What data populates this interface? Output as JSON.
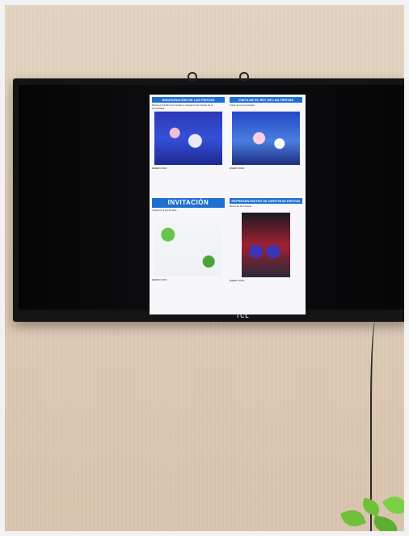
{
  "tv": {
    "brand": "TCL"
  },
  "document": {
    "panels": [
      {
        "heading": "INAUGURACIÓN DE LAS FIESTAS",
        "subtitle": "Ramírez Carrillo fue invitado a inaugurar las fiestas de la Comunidad",
        "caption": "ENERO 2024"
      },
      {
        "heading": "VISITA DE EL REY DE LAS FIESTAS",
        "subtitle": "Visita de la Comunidad",
        "caption": "ENERO 2024"
      },
      {
        "heading": "INVITACIÓN",
        "subtitle": "Invitación a las Fiestas",
        "caption": "ENERO 2024"
      },
      {
        "heading": "REPRESENTANTES DE NUESTRAS FIESTAS",
        "subtitle": "Reina de las Fiestas",
        "caption": "ENERO 2024"
      }
    ]
  }
}
